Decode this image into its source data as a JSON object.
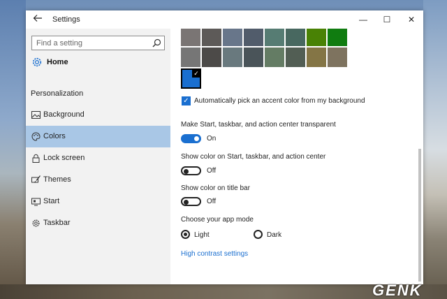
{
  "window": {
    "title": "Settings",
    "back_icon": "back-arrow-icon",
    "minimize_glyph": "—",
    "maximize_glyph": "☐",
    "close_glyph": "✕"
  },
  "search": {
    "placeholder": "Find a setting",
    "icon": "search-icon"
  },
  "home": {
    "label": "Home",
    "icon": "gear-icon"
  },
  "section": "Personalization",
  "nav": [
    {
      "label": "Background",
      "icon": "image-icon",
      "active": false
    },
    {
      "label": "Colors",
      "icon": "palette-icon",
      "active": true
    },
    {
      "label": "Lock screen",
      "icon": "lock-icon",
      "active": false
    },
    {
      "label": "Themes",
      "icon": "brush-icon",
      "active": false
    },
    {
      "label": "Start",
      "icon": "start-icon",
      "active": false
    },
    {
      "label": "Taskbar",
      "icon": "taskbar-gear-icon",
      "active": false
    }
  ],
  "swatches_row1": [
    "#7a7574",
    "#5d5a58",
    "#68768a",
    "#515c6b",
    "#567c73",
    "#486860",
    "#498205",
    "#107c10"
  ],
  "swatches_row2": [
    "#767676",
    "#4c4a48",
    "#69797e",
    "#4a5459",
    "#647c64",
    "#525e54",
    "#847545",
    "#7e735f"
  ],
  "selected_color": "#1a6fd0",
  "auto_accent": {
    "label": "Automatically pick an accent color from my background",
    "checked": true
  },
  "transparent": {
    "label": "Make Start, taskbar, and action center transparent",
    "state": "On"
  },
  "color_start": {
    "label": "Show color on Start, taskbar, and action center",
    "state": "Off"
  },
  "color_title": {
    "label": "Show color on title bar",
    "state": "Off"
  },
  "app_mode": {
    "label": "Choose your app mode",
    "light": "Light",
    "dark": "Dark",
    "selected": "Light"
  },
  "high_contrast_link": "High contrast settings",
  "watermark": "GENK"
}
